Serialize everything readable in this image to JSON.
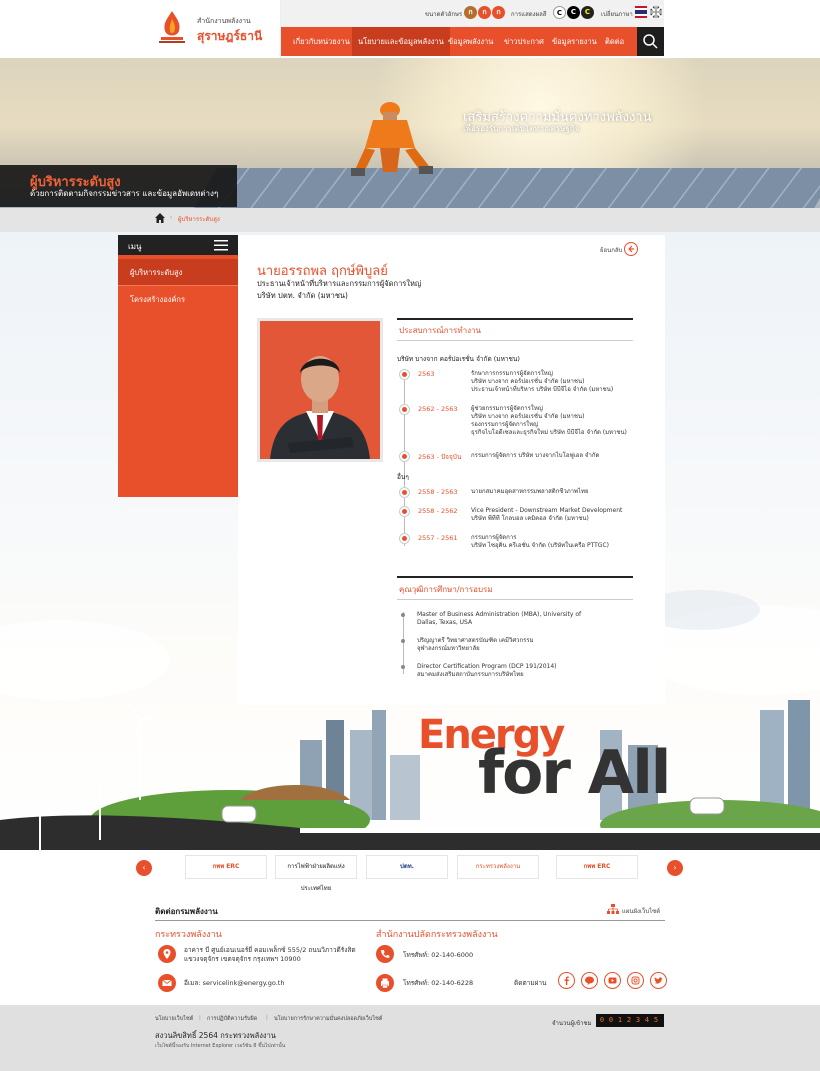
{
  "header": {
    "logo_line1": "สำนักงานพลังงาน",
    "logo_line2": "สุราษฎร์ธานี",
    "font_size_label": "ขนาดตัวอักษร",
    "font_sizes": [
      "ก",
      "ก",
      "ก"
    ],
    "contrast_label": "การแสดงผลสี",
    "contrast_options": [
      "C",
      "C",
      "C"
    ],
    "lang_label": "เปลี่ยนภาษา"
  },
  "nav": {
    "items": [
      "เกี่ยวกับหน่วยงาน",
      "นโยบายและข้อมูลพลังงาน",
      "ข้อมูลพลังงาน",
      "ข่าวประกาศ",
      "ข้อมูลรายงาน",
      "ติดต่อ"
    ]
  },
  "hero": {
    "tagline1": "เสริมสร้างความมั่นคงทางพลังงาน",
    "tagline2": "เพื่อรองรับการเติบโตทางเศรษฐกิจ",
    "page_title": "ผู้บริหารระดับสูง",
    "page_subtitle": "ด้วยการติดตามกิจกรรมข่าวสาร และข้อมูลอัพเดทต่างๆ"
  },
  "breadcrumb": {
    "current": "ผู้บริหารระดับสูง"
  },
  "sidebar": {
    "title": "เมนู",
    "items": [
      "ผู้บริหารระดับสูง",
      "โครงสร้างองค์กร"
    ]
  },
  "profile": {
    "back_label": "ย้อนกลับ",
    "name": "นายอรรถพล  ฤกษ์พิบูลย์",
    "position": "ประธานเจ้าหน้าที่บริหารและกรรมการผู้จัดการใหญ่",
    "company": "บริษัท ปตท. จำกัด (มหาชน)"
  },
  "experience": {
    "title": "ประสบการณ์การทำงาน",
    "group1": "บริษัท บางจาก คอร์ปอเรชั่น จำกัด (มหาชน)",
    "items1": [
      {
        "year": "2563",
        "desc": "รักษาการกรรมการผู้จัดการใหญ่\nบริษัท บางจาก คอร์ปอเรชั่น จำกัด (มหาชน)\nประธานเจ้าหน้าที่บริหาร บริษัท บีบีจีไอ จำกัด (มหาชน)"
      },
      {
        "year": "2562 - 2563",
        "desc": "ผู้ช่วยกรรมการผู้จัดการใหญ่\nบริษัท บางจาก คอร์ปอเรชั่น จำกัด (มหาชน)\nรองกรรมการผู้จัดการใหญ่\nธุรกิจไบโอดีเซลและธุรกิจใหม่ บริษัท บีบีจีไอ จำกัด (มหาชน)"
      },
      {
        "year": "2563 - ปัจจุบัน",
        "desc": "กรรมการผู้จัดการ บริษัท บางจากไบโอฟูเอล จำกัด"
      }
    ],
    "group2": "อื่นๆ",
    "items2": [
      {
        "year": "2558 - 2563",
        "desc": "นายกสมาคมอุตสาหกรรมพลาสติกชีวภาพไทย"
      },
      {
        "year": "2558 - 2562",
        "desc": "Vice President - Downstream Market Development\nบริษัท พีทีที โกลบอล เคมิคอล จำกัด (มหาชน)"
      },
      {
        "year": "2557 - 2561",
        "desc": "กรรมการผู้จัดการ\nบริษัท ไซอุคิน ครีเอชั่น จำกัด (บริษัทในเครือ PTTGC)"
      }
    ]
  },
  "education": {
    "title": "คุณวุฒิการศึกษา/การอบรม",
    "items": [
      "Master of Business Administration (MBA), University of\nDallas, Texas, USA",
      "ปริญญาตรี วิทยาศาสตรบัณฑิต เคมีวิศวกรรม\nจุฬาลงกรณ์มหาวิทยาลัย",
      "Director Certification Program (DCP 191/2014)\nสมาคมส่งเสริมสถาบันกรรมการบริษัทไทย"
    ]
  },
  "banner": {
    "word1": "Energy",
    "word2": "for All"
  },
  "partners": {
    "logos": [
      "กพพ ERC",
      "การไฟฟ้าฝ่ายผลิตแห่งประเทศไทย",
      "ปตท.",
      "กระทรวงพลังงาน",
      "กพพ ERC"
    ]
  },
  "contact": {
    "title": "ติดต่อกรมพลังงาน",
    "sitemap_label": "แผนผังเว็บไซต์",
    "col1_head": "กระทรวงพลังงาน",
    "address": "อาคาร บี ศูนย์เอนเนอร์ยี่ คอมเพล็กซ์ 555/2 ถนนวิภาวดีรังสิต\nแขวงจตุจักร เขตจตุจักร กรุงเทพฯ 10900",
    "email": "อีเมล: servicelink@energy.go.th",
    "col2_head": "สำนักงานปลัดกระทรวงพลังงาน",
    "phone": "โทรศัพท์: 02-140-6000",
    "fax": "โทรศัพท์: 02-140-6228",
    "follow_label": "ติดตามผ่าน"
  },
  "footer": {
    "links": [
      "นโยบายเว็บไซต์",
      "การปฏิบัติความรับผิด",
      "นโยบายการรักษาความมั่นคงปลอดภัยเว็บไซต์"
    ],
    "copyright": "สงวนลิขสิทธิ์ 2564 กระทรวงพลังงาน",
    "browser_note": "เว็บไซต์นี้รองรับ Internet Explorer เวอร์ชัน 8 ขึ้นไปเท่านั้น",
    "visitor_label": "จำนวนผู้เข้าชม",
    "visitor_digits": [
      "0",
      "0",
      "1",
      "2",
      "3",
      "4",
      "5"
    ]
  },
  "colors": {
    "accent": "#e8502c",
    "dark": "#222222"
  }
}
